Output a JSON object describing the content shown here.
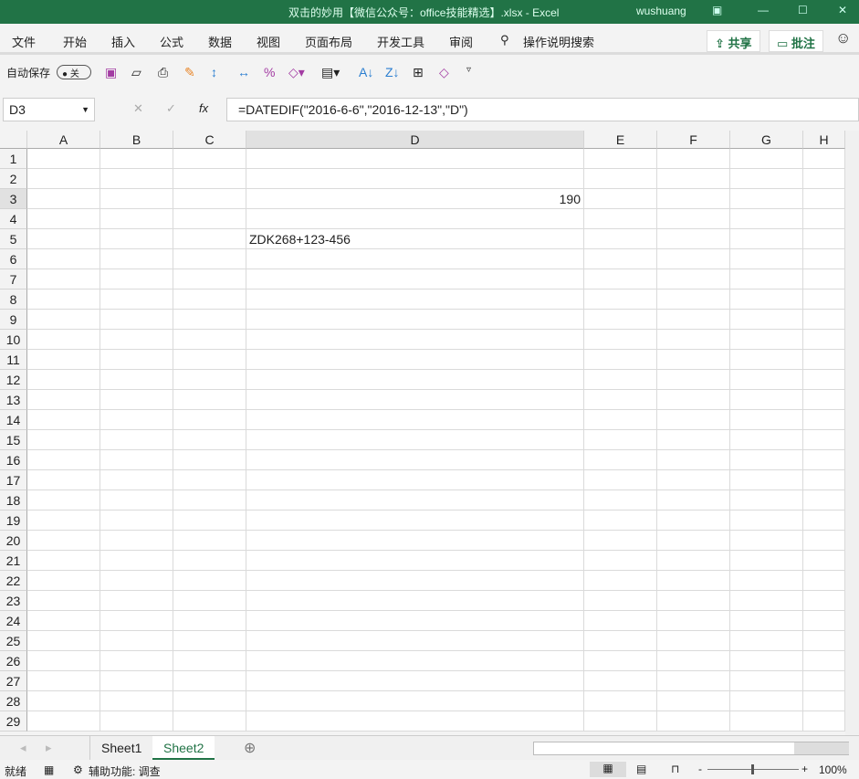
{
  "title": "双击的妙用【微信公众号：office技能精选】.xlsx  -  Excel",
  "user": "wushuang",
  "menu": [
    "文件",
    "开始",
    "插入",
    "公式",
    "数据",
    "视图",
    "页面布局",
    "开发工具",
    "审阅"
  ],
  "search": "操作说明搜索",
  "share": "共享",
  "comment": "批注",
  "autosave": "自动保存",
  "autosave_state": "关",
  "namebox": "D3",
  "formula": "=DATEDIF(\"2016-6-6\",\"2016-12-13\",\"D\")",
  "columns": [
    "A",
    "B",
    "C",
    "D",
    "E",
    "F",
    "G",
    "H"
  ],
  "row_count": 29,
  "cells": [
    {
      "ref": "D3",
      "row": 3,
      "col": "D",
      "value": "190",
      "align": "right"
    },
    {
      "ref": "D5",
      "row": 5,
      "col": "D",
      "value": "ZDK268+123-456",
      "align": "left"
    }
  ],
  "sheets": [
    "Sheet1",
    "Sheet2"
  ],
  "active_sheet": "Sheet2",
  "status": {
    "ready": "就绪",
    "accessibility": "辅助功能: 调查",
    "zoom": "100%"
  }
}
